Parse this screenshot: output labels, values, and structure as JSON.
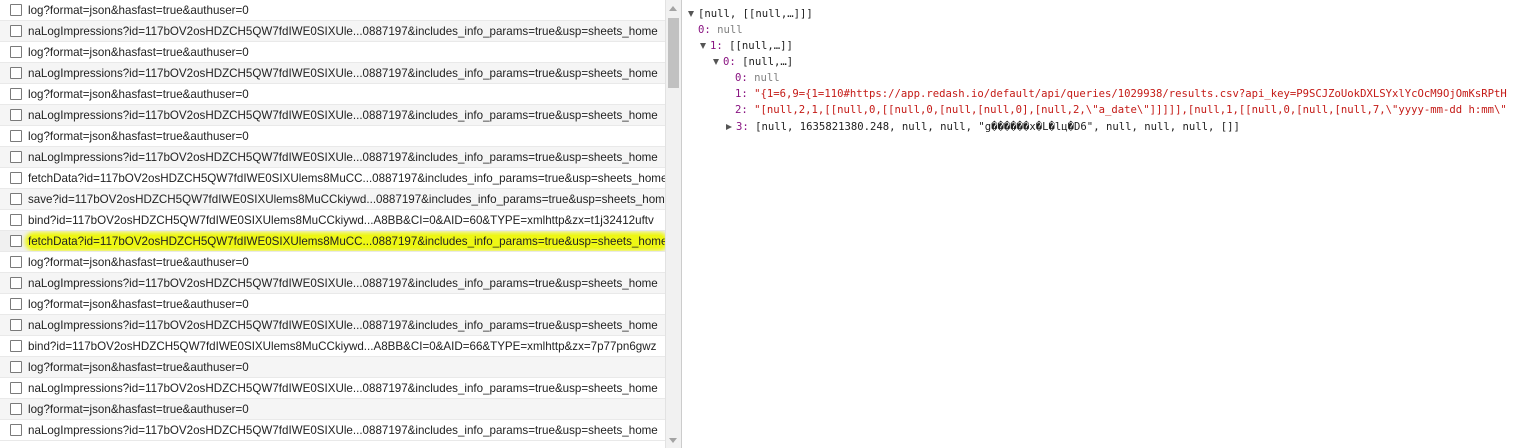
{
  "requests": [
    {
      "name": "log?format=json&hasfast=true&authuser=0"
    },
    {
      "name": "naLogImpressions?id=117bOV2osHDZCH5QW7fdIWE0SIXUle...0887197&includes_info_params=true&usp=sheets_home"
    },
    {
      "name": "log?format=json&hasfast=true&authuser=0"
    },
    {
      "name": "naLogImpressions?id=117bOV2osHDZCH5QW7fdIWE0SIXUle...0887197&includes_info_params=true&usp=sheets_home"
    },
    {
      "name": "log?format=json&hasfast=true&authuser=0"
    },
    {
      "name": "naLogImpressions?id=117bOV2osHDZCH5QW7fdIWE0SIXUle...0887197&includes_info_params=true&usp=sheets_home"
    },
    {
      "name": "log?format=json&hasfast=true&authuser=0"
    },
    {
      "name": "naLogImpressions?id=117bOV2osHDZCH5QW7fdIWE0SIXUle...0887197&includes_info_params=true&usp=sheets_home"
    },
    {
      "name": "fetchData?id=117bOV2osHDZCH5QW7fdIWE0SIXUlems8MuCC...0887197&includes_info_params=true&usp=sheets_home"
    },
    {
      "name": "save?id=117bOV2osHDZCH5QW7fdIWE0SIXUlems8MuCCkiywd...0887197&includes_info_params=true&usp=sheets_home"
    },
    {
      "name": "bind?id=117bOV2osHDZCH5QW7fdIWE0SIXUlems8MuCCkiywd...A8BB&CI=0&AID=60&TYPE=xmlhttp&zx=t1j32412uftv"
    },
    {
      "name": "fetchData?id=117bOV2osHDZCH5QW7fdIWE0SIXUlems8MuCC...0887197&includes_info_params=true&usp=sheets_home"
    },
    {
      "name": "log?format=json&hasfast=true&authuser=0"
    },
    {
      "name": "naLogImpressions?id=117bOV2osHDZCH5QW7fdIWE0SIXUle...0887197&includes_info_params=true&usp=sheets_home"
    },
    {
      "name": "log?format=json&hasfast=true&authuser=0"
    },
    {
      "name": "naLogImpressions?id=117bOV2osHDZCH5QW7fdIWE0SIXUle...0887197&includes_info_params=true&usp=sheets_home"
    },
    {
      "name": "bind?id=117bOV2osHDZCH5QW7fdIWE0SIXUlems8MuCCkiywd...A8BB&CI=0&AID=66&TYPE=xmlhttp&zx=7p77pn6gwz"
    },
    {
      "name": "log?format=json&hasfast=true&authuser=0"
    },
    {
      "name": "naLogImpressions?id=117bOV2osHDZCH5QW7fdIWE0SIXUle...0887197&includes_info_params=true&usp=sheets_home"
    },
    {
      "name": "log?format=json&hasfast=true&authuser=0"
    },
    {
      "name": "naLogImpressions?id=117bOV2osHDZCH5QW7fdIWE0SIXUle...0887197&includes_info_params=true&usp=sheets_home"
    }
  ],
  "highlighted_index": 11,
  "colors": {
    "highlight": "#eef714",
    "key": "#881280",
    "null": "#808080",
    "string": "#c41a16"
  },
  "tree": [
    {
      "id": "root",
      "toggle": "open",
      "key": "",
      "value": "[null, [[null,…]]]",
      "type": "plain"
    },
    {
      "id": "k0",
      "toggle": "none",
      "key": "0:",
      "value": "null",
      "type": "null"
    },
    {
      "id": "k1",
      "toggle": "open",
      "key": "1:",
      "value": "[[null,…]]",
      "type": "plain"
    },
    {
      "id": "k1-0",
      "toggle": "open",
      "key": "0:",
      "value": "[null,…]",
      "type": "plain"
    },
    {
      "id": "k1-0-0",
      "toggle": "none",
      "key": "0:",
      "value": "null",
      "type": "null"
    },
    {
      "id": "k1-0-1",
      "toggle": "none",
      "key": "1:",
      "value": "\"{1=6,9={1=110#https://app.redash.io/default/api/queries/1029938/results.csv?api_key=P9SCJZoUokDXLSYxlYcOcM9OjOmKsRPtH",
      "type": "string"
    },
    {
      "id": "k1-0-2",
      "toggle": "none",
      "key": "2:",
      "value": "\"[null,2,1,[[null,0,[[null,0,[null,[null,0],[null,2,\\\"a_date\\\"]]]]],[null,1,[[null,0,[null,[null,7,\\\"yyyy-mm-dd h:mm\\\"",
      "type": "string"
    },
    {
      "id": "k1-0-3",
      "toggle": "closed",
      "key": "3:",
      "value": "[null, 1635821380.248, null, null, \"g������x�L�lц�D6\", null, null, null, []]",
      "type": "plain"
    }
  ]
}
